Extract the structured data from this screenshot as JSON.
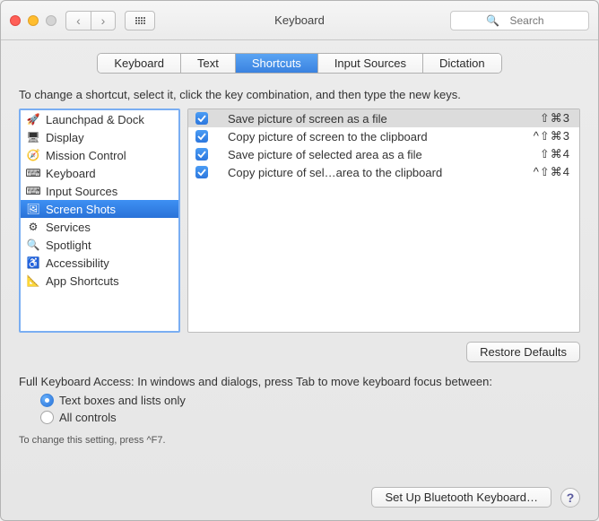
{
  "window": {
    "title": "Keyboard"
  },
  "search": {
    "placeholder": "Search"
  },
  "tabs": [
    "Keyboard",
    "Text",
    "Shortcuts",
    "Input Sources",
    "Dictation"
  ],
  "active_tab_index": 2,
  "instruction": "To change a shortcut, select it, click the key combination, and then type the new keys.",
  "categories": [
    {
      "label": "Launchpad & Dock",
      "icon": "🚀"
    },
    {
      "label": "Display",
      "icon": "🖥"
    },
    {
      "label": "Mission Control",
      "icon": "🧭"
    },
    {
      "label": "Keyboard",
      "icon": "⌨"
    },
    {
      "label": "Input Sources",
      "icon": "⌨"
    },
    {
      "label": "Screen Shots",
      "icon": "🖼"
    },
    {
      "label": "Services",
      "icon": "⚙"
    },
    {
      "label": "Spotlight",
      "icon": "🔍"
    },
    {
      "label": "Accessibility",
      "icon": "♿"
    },
    {
      "label": "App Shortcuts",
      "icon": "📐"
    }
  ],
  "selected_category_index": 5,
  "shortcuts": [
    {
      "checked": true,
      "label": "Save picture of screen as a file",
      "keys": "⇧⌘3",
      "selected": true
    },
    {
      "checked": true,
      "label": "Copy picture of screen to the clipboard",
      "keys": "^⇧⌘3",
      "selected": false
    },
    {
      "checked": true,
      "label": "Save picture of selected area as a file",
      "keys": "⇧⌘4",
      "selected": false
    },
    {
      "checked": true,
      "label": "Copy picture of sel…area to the clipboard",
      "keys": "^⇧⌘4",
      "selected": false
    }
  ],
  "restore_label": "Restore Defaults",
  "fka": {
    "text": "Full Keyboard Access: In windows and dialogs, press Tab to move keyboard focus between:",
    "options": [
      "Text boxes and lists only",
      "All controls"
    ],
    "selected": 0,
    "hint": "To change this setting, press ^F7."
  },
  "footer": {
    "bluetooth_btn": "Set Up Bluetooth Keyboard…"
  }
}
